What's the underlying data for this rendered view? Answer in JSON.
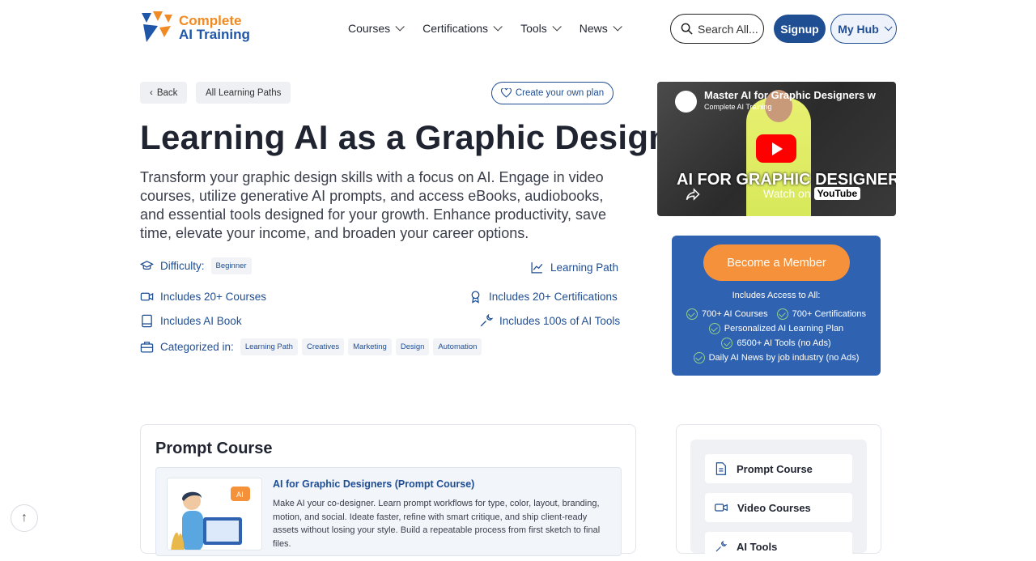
{
  "brand": {
    "line1": "Complete",
    "line2": "AI Training",
    "colors": {
      "orange": "#f08a24",
      "blue": "#1f56a8"
    }
  },
  "nav": {
    "items": [
      {
        "label": "Courses"
      },
      {
        "label": "Certifications"
      },
      {
        "label": "Tools"
      },
      {
        "label": "News"
      }
    ],
    "search_placeholder": "Search All...",
    "signup": "Signup",
    "myhub": "My Hub"
  },
  "toolbar": {
    "back": "Back",
    "all_paths": "All Learning Paths",
    "create_plan": "Create your own plan"
  },
  "page": {
    "title": "Learning AI as a Graphic Designer",
    "description": "Transform your graphic design skills with a focus on AI. Engage in video courses, utilize generative AI prompts, and access eBooks, audiobooks, and essential tools designed for your growth. Enhance productivity, save time, elevate your income, and broaden your career options."
  },
  "meta": {
    "difficulty_label": "Difficulty:",
    "difficulty_value": "Beginner",
    "learning_path": "Learning Path",
    "courses": "Includes 20+ Courses",
    "certifications": "Includes 20+ Certifications",
    "book": "Includes AI Book",
    "tools": "Includes 100s of AI Tools",
    "categorized_label": "Categorized in:",
    "tags": [
      "Learning Path",
      "Creatives",
      "Marketing",
      "Design",
      "Automation"
    ]
  },
  "video": {
    "title": "Master AI for Graphic Designers w",
    "channel": "Complete AI Training",
    "overlay": "AI FOR GRAPHIC DESIGNERS",
    "watch_on": "Watch on",
    "platform": "YouTube"
  },
  "member": {
    "cta": "Become a Member",
    "access_title": "Includes Access to All:",
    "items": [
      "700+ AI Courses",
      "700+ Certifications",
      "Personalized AI Learning Plan",
      "6500+ AI Tools (no Ads)",
      "Daily AI News by job industry (no Ads)"
    ]
  },
  "course_card": {
    "heading": "Prompt Course",
    "title": "AI for Graphic Designers (Prompt Course)",
    "description": "Make AI your co-designer. Learn prompt workflows for type, color, layout, branding, motion, and social. Ideate faster, refine with smart critique, and ship client-ready assets without losing your style. Build a repeatable process from first sketch to final files."
  },
  "side_nav": {
    "items": [
      {
        "label": "Prompt Course",
        "icon": "document-icon"
      },
      {
        "label": "Video Courses",
        "icon": "video-icon"
      },
      {
        "label": "AI Tools",
        "icon": "tool-icon"
      }
    ]
  }
}
